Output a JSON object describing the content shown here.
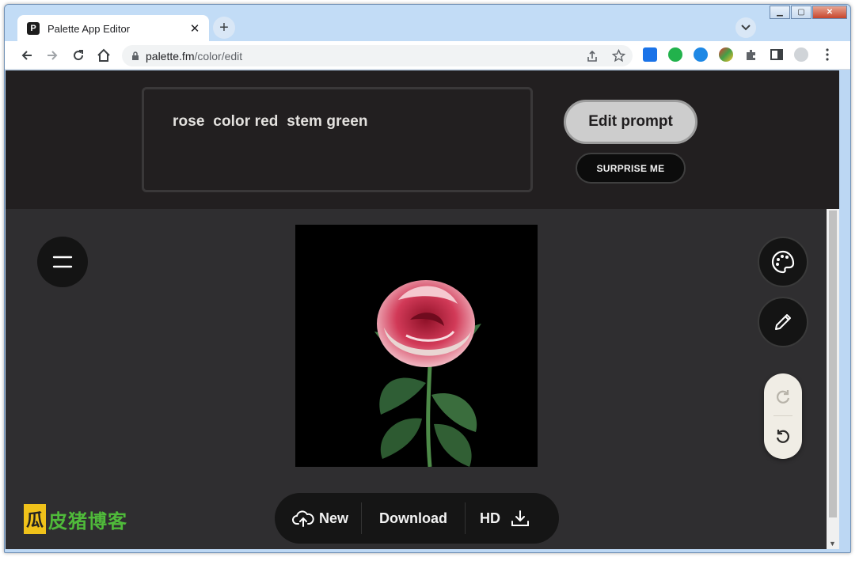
{
  "browser": {
    "tab_title": "Palette App Editor",
    "tab_favicon": "P",
    "url_domain": "palette.fm",
    "url_path": "/color/edit"
  },
  "prompt": {
    "text": "rose  color red  stem green",
    "edit_label": "Edit prompt",
    "surprise_label": "SURPRISE ME"
  },
  "bottom_bar": {
    "new_label": "New",
    "download_label": "Download",
    "hd_label": "HD"
  },
  "watermark": {
    "logo_char": "瓜",
    "text": "皮猪博客"
  },
  "colors": {
    "page_bg": "#2f2e30",
    "header_bg": "#221f20",
    "edit_button": "#cdcdcd",
    "undo_pill": "#f0ede5",
    "watermark_green": "#4fba3a"
  },
  "icons": [
    "hamburger-menu-icon",
    "palette-icon",
    "pencil-icon",
    "redo-icon",
    "undo-icon",
    "cloud-upload-icon",
    "download-icon"
  ]
}
